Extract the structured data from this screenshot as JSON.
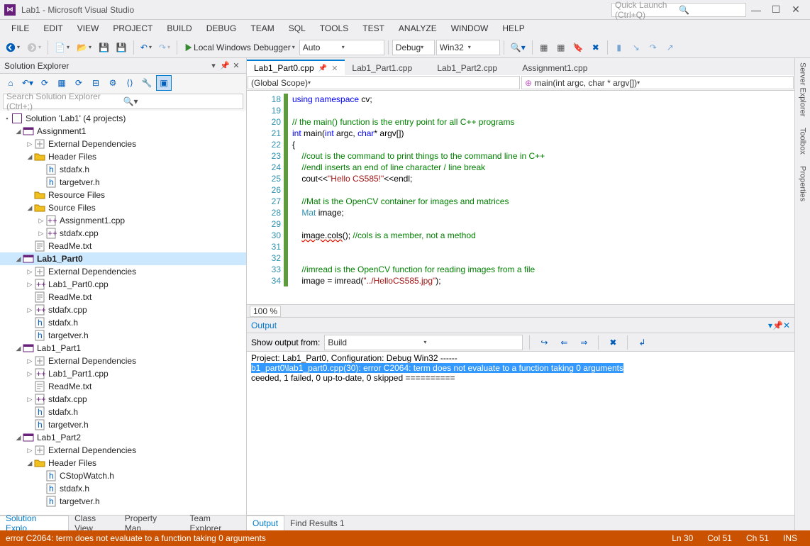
{
  "title": "Lab1 - Microsoft Visual Studio",
  "quickLaunch": "Quick Launch (Ctrl+Q)",
  "menus": [
    "FILE",
    "EDIT",
    "VIEW",
    "PROJECT",
    "BUILD",
    "DEBUG",
    "TEAM",
    "SQL",
    "TOOLS",
    "TEST",
    "ANALYZE",
    "WINDOW",
    "HELP"
  ],
  "toolbar": {
    "debugger": "Local Windows Debugger",
    "platform": "Auto",
    "config": "Debug",
    "arch": "Win32"
  },
  "solutionExplorer": {
    "title": "Solution Explorer",
    "searchPlaceholder": "Search Solution Explorer (Ctrl+;)",
    "solution": "Solution 'Lab1' (4 projects)",
    "tree": [
      {
        "d": 1,
        "exp": "▪",
        "ico": "proj",
        "lbl": "Assignment1"
      },
      {
        "d": 2,
        "exp": "▹",
        "ico": "ref",
        "lbl": "External Dependencies"
      },
      {
        "d": 2,
        "exp": "▪",
        "ico": "fold",
        "lbl": "Header Files"
      },
      {
        "d": 3,
        "exp": "",
        "ico": "h",
        "lbl": "stdafx.h"
      },
      {
        "d": 3,
        "exp": "",
        "ico": "h",
        "lbl": "targetver.h"
      },
      {
        "d": 2,
        "exp": "",
        "ico": "fold",
        "lbl": "Resource Files"
      },
      {
        "d": 2,
        "exp": "▪",
        "ico": "fold",
        "lbl": "Source Files"
      },
      {
        "d": 3,
        "exp": "▹",
        "ico": "cpp",
        "lbl": "Assignment1.cpp"
      },
      {
        "d": 3,
        "exp": "▹",
        "ico": "cpp",
        "lbl": "stdafx.cpp"
      },
      {
        "d": 2,
        "exp": "",
        "ico": "txt",
        "lbl": "ReadMe.txt"
      },
      {
        "d": 1,
        "exp": "▪",
        "ico": "proj",
        "lbl": "Lab1_Part0",
        "bold": true,
        "sel": true
      },
      {
        "d": 2,
        "exp": "▹",
        "ico": "ref",
        "lbl": "External Dependencies"
      },
      {
        "d": 2,
        "exp": "▹",
        "ico": "cpp",
        "lbl": "Lab1_Part0.cpp"
      },
      {
        "d": 2,
        "exp": "",
        "ico": "txt",
        "lbl": "ReadMe.txt"
      },
      {
        "d": 2,
        "exp": "▹",
        "ico": "cpp",
        "lbl": "stdafx.cpp"
      },
      {
        "d": 2,
        "exp": "",
        "ico": "h",
        "lbl": "stdafx.h"
      },
      {
        "d": 2,
        "exp": "",
        "ico": "h",
        "lbl": "targetver.h"
      },
      {
        "d": 1,
        "exp": "▪",
        "ico": "proj",
        "lbl": "Lab1_Part1"
      },
      {
        "d": 2,
        "exp": "▹",
        "ico": "ref",
        "lbl": "External Dependencies"
      },
      {
        "d": 2,
        "exp": "▹",
        "ico": "cpp",
        "lbl": "Lab1_Part1.cpp"
      },
      {
        "d": 2,
        "exp": "",
        "ico": "txt",
        "lbl": "ReadMe.txt"
      },
      {
        "d": 2,
        "exp": "▹",
        "ico": "cpp",
        "lbl": "stdafx.cpp"
      },
      {
        "d": 2,
        "exp": "",
        "ico": "h",
        "lbl": "stdafx.h"
      },
      {
        "d": 2,
        "exp": "",
        "ico": "h",
        "lbl": "targetver.h"
      },
      {
        "d": 1,
        "exp": "▪",
        "ico": "proj",
        "lbl": "Lab1_Part2"
      },
      {
        "d": 2,
        "exp": "▹",
        "ico": "ref",
        "lbl": "External Dependencies"
      },
      {
        "d": 2,
        "exp": "▪",
        "ico": "fold",
        "lbl": "Header Files"
      },
      {
        "d": 3,
        "exp": "",
        "ico": "h",
        "lbl": "CStopWatch.h"
      },
      {
        "d": 3,
        "exp": "",
        "ico": "h",
        "lbl": "stdafx.h"
      },
      {
        "d": 3,
        "exp": "",
        "ico": "h",
        "lbl": "targetver.h"
      }
    ]
  },
  "leftTabs": [
    "Solution Explo...",
    "Class View",
    "Property Man...",
    "Team Explorer"
  ],
  "editorTabs": [
    {
      "label": "Lab1_Part0.cpp",
      "active": true,
      "pinned": true
    },
    {
      "label": "Lab1_Part1.cpp"
    },
    {
      "label": "Lab1_Part2.cpp"
    },
    {
      "label": "Assignment1.cpp"
    }
  ],
  "scope": {
    "left": "(Global Scope)",
    "right": "main(int argc, char * argv[])"
  },
  "zoom": "100 %",
  "code": {
    "start": 18,
    "lines": [
      {
        "tokens": [
          [
            "kw",
            "using"
          ],
          [
            "",
            " "
          ],
          [
            "kw",
            "namespace"
          ],
          [
            "",
            " cv;"
          ]
        ]
      },
      {
        "tokens": []
      },
      {
        "tokens": [
          [
            "cm",
            "// the main() function is the entry point for all C++ programs"
          ]
        ]
      },
      {
        "tokens": [
          [
            "kw",
            "int"
          ],
          [
            "",
            " main("
          ],
          [
            "kw",
            "int"
          ],
          [
            "",
            " argc, "
          ],
          [
            "kw",
            "char"
          ],
          [
            "",
            "* argv[])"
          ]
        ],
        "collapse": true
      },
      {
        "tokens": [
          [
            "",
            "{"
          ]
        ]
      },
      {
        "i": 1,
        "tokens": [
          [
            "cm",
            "//cout is the command to print things to the command line in C++"
          ]
        ]
      },
      {
        "i": 1,
        "tokens": [
          [
            "cm",
            "//endl inserts an end of line character / line break"
          ]
        ]
      },
      {
        "i": 1,
        "tokens": [
          [
            "",
            "cout<<"
          ],
          [
            "st",
            "\"Hello CS585!\""
          ],
          [
            "",
            "<<endl;"
          ]
        ]
      },
      {
        "tokens": []
      },
      {
        "i": 1,
        "tokens": [
          [
            "cm",
            "//Mat is the OpenCV container for images and matrices"
          ]
        ]
      },
      {
        "i": 1,
        "tokens": [
          [
            "ty",
            "Mat"
          ],
          [
            "",
            " image;"
          ]
        ]
      },
      {
        "tokens": []
      },
      {
        "i": 1,
        "tokens": [
          [
            "err",
            "image.cols"
          ],
          [
            "",
            "(); "
          ],
          [
            "cm",
            "//cols is a member, not a method"
          ]
        ]
      },
      {
        "tokens": []
      },
      {
        "tokens": []
      },
      {
        "i": 1,
        "tokens": [
          [
            "cm",
            "//imread is the OpenCV function for reading images from a file"
          ]
        ]
      },
      {
        "i": 1,
        "tokens": [
          [
            "",
            "image = imread("
          ],
          [
            "st",
            "\"../HelloCS585.jpg\""
          ],
          [
            "",
            ");"
          ]
        ]
      }
    ]
  },
  "output": {
    "title": "Output",
    "showFrom": "Show output from:",
    "source": "Build",
    "lines": [
      {
        "t": "  Project: Lab1_Part0, Configuration: Debug Win32 ------"
      },
      {
        "t": "b1_part0\\lab1_part0.cpp(30): error C2064: term does not evaluate to a function taking 0 arguments",
        "hl": true
      },
      {
        "t": "ceeded, 1 failed, 0 up-to-date, 0 skipped =========="
      }
    ]
  },
  "rightTabs": [
    "Output",
    "Find Results 1"
  ],
  "sideTabs": [
    "Server Explorer",
    "Toolbox",
    "Properties"
  ],
  "status": {
    "msg": "error C2064: term does not evaluate to a function taking 0 arguments",
    "ln": "Ln 30",
    "col": "Col 51",
    "ch": "Ch 51",
    "ins": "INS"
  }
}
